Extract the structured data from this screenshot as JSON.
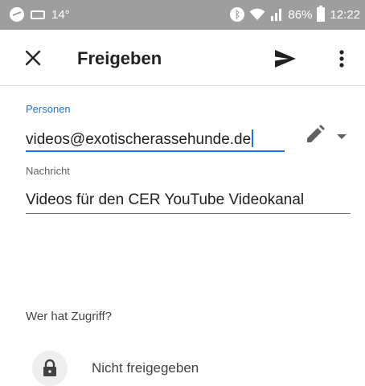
{
  "status_bar": {
    "temperature": "14°",
    "battery": "86%",
    "time": "12:22"
  },
  "toolbar": {
    "title": "Freigeben",
    "close_icon": "close-icon",
    "send_icon": "send-icon",
    "more_icon": "more-vertical-icon"
  },
  "form": {
    "persons_label": "Personen",
    "persons_value": "videos@exotischerassehunde.de",
    "message_label": "Nachricht",
    "message_value": "Videos für den CER YouTube Videokanal"
  },
  "access": {
    "heading": "Wer hat Zugriff?",
    "status": "Nicht freigegeben",
    "icon": "lock-icon"
  },
  "colors": {
    "accent": "#1a73e8",
    "status_bar": "#9e9e9e"
  }
}
